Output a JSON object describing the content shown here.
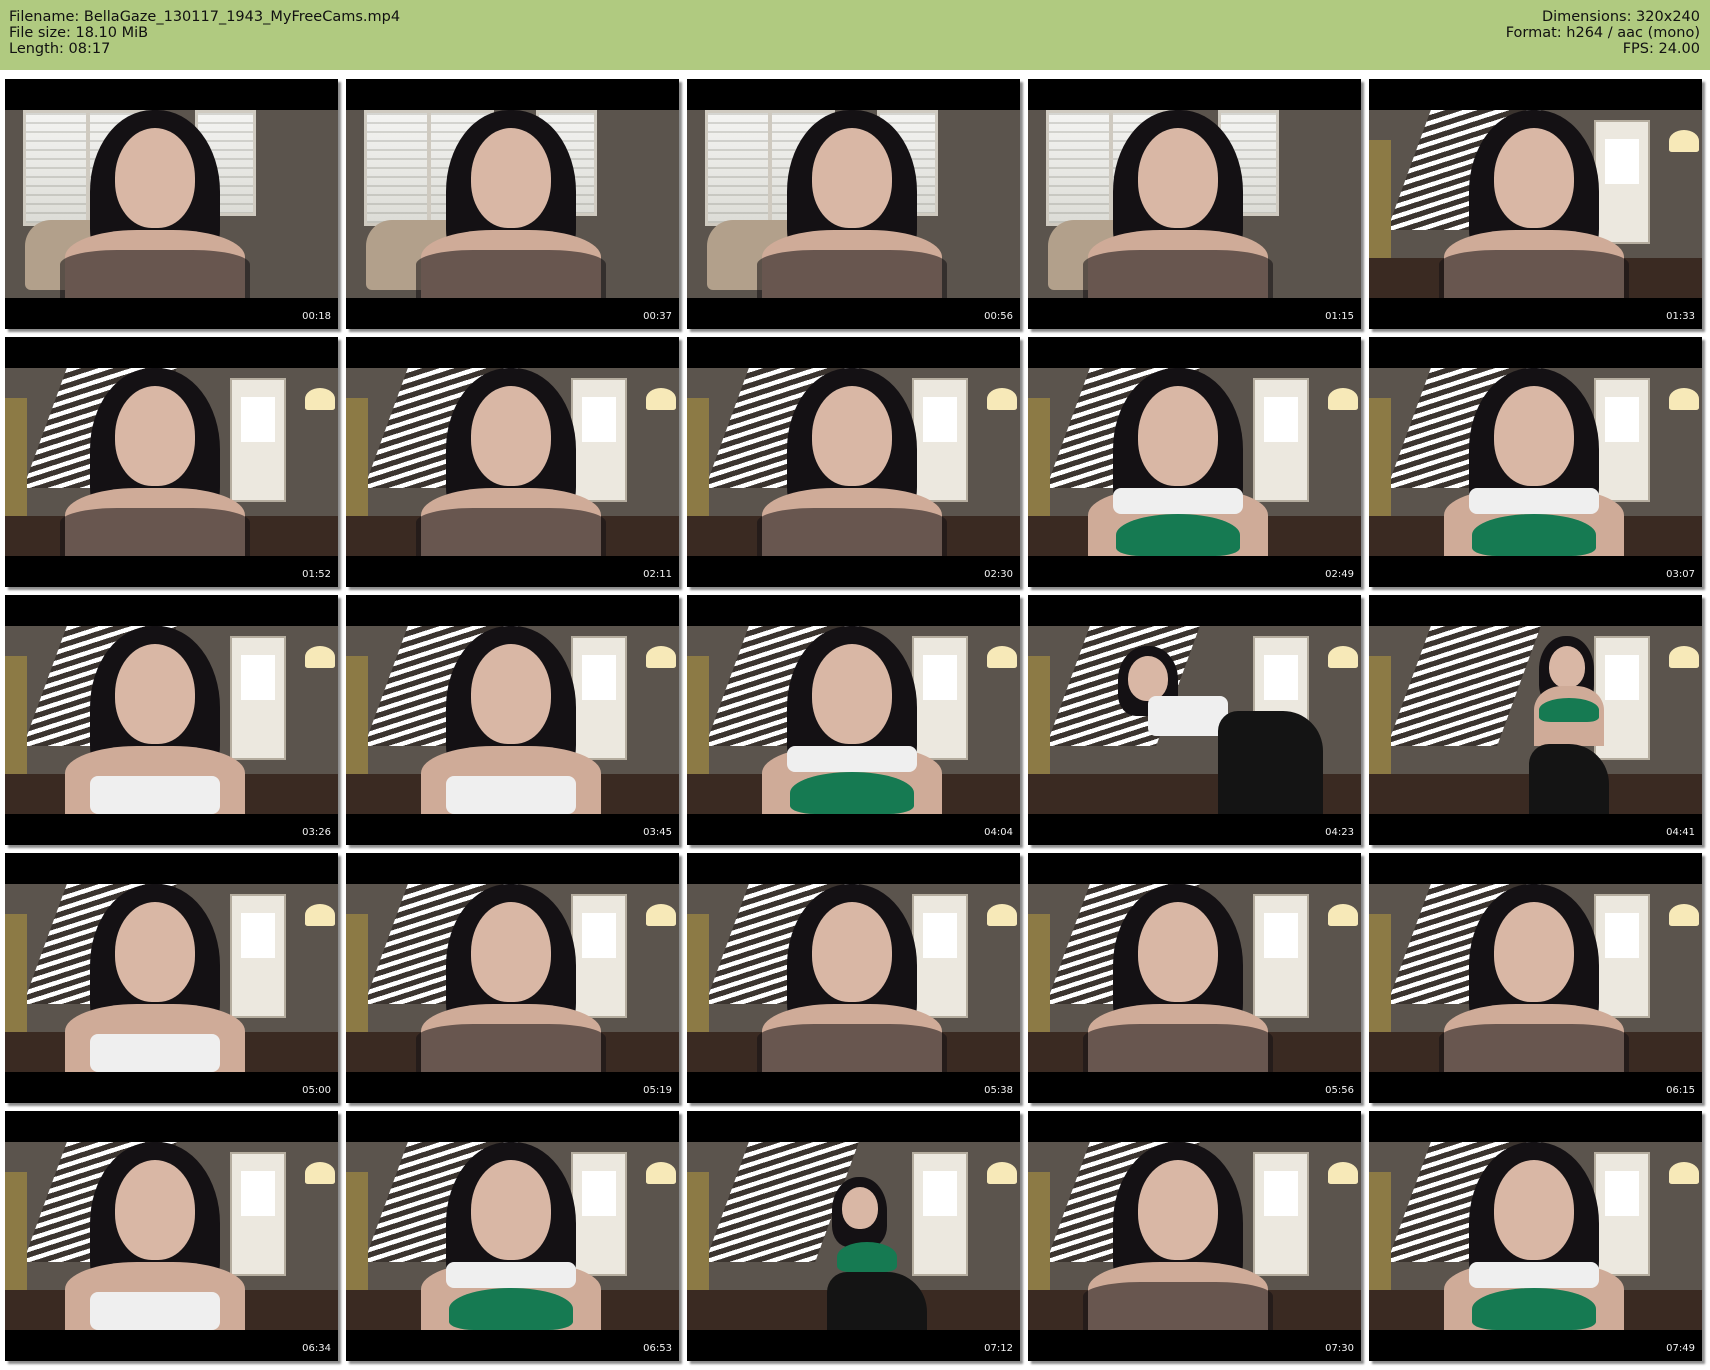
{
  "header": {
    "filename": "Filename: BellaGaze_130117_1943_MyFreeCams.mp4",
    "filesize": "File size: 18.10 MiB",
    "length": "Length: 08:17",
    "dimensions": "Dimensions: 320x240",
    "format": "Format: h264 / aac (mono)",
    "fps": "FPS: 24.00"
  },
  "colors": {
    "header_bg": "#b0ca80",
    "page_bg": "#ffffff",
    "frame_bg": "#000000",
    "timestamp_text": "#f2f2f2"
  },
  "thumbnails": [
    {
      "time": "00:18",
      "scene": "living",
      "outfit": "dark"
    },
    {
      "time": "00:37",
      "scene": "living",
      "outfit": "dark"
    },
    {
      "time": "00:56",
      "scene": "living",
      "outfit": "dark"
    },
    {
      "time": "01:15",
      "scene": "living",
      "outfit": "dark"
    },
    {
      "time": "01:33",
      "scene": "stairs",
      "outfit": "dark"
    },
    {
      "time": "01:52",
      "scene": "stairs",
      "outfit": "dark"
    },
    {
      "time": "02:11",
      "scene": "stairs",
      "outfit": "dark"
    },
    {
      "time": "02:30",
      "scene": "stairs",
      "outfit": "dark"
    },
    {
      "time": "02:49",
      "scene": "stairs",
      "outfit": "green"
    },
    {
      "time": "03:07",
      "scene": "stairs",
      "outfit": "green"
    },
    {
      "time": "03:26",
      "scene": "stairs",
      "outfit": "white"
    },
    {
      "time": "03:45",
      "scene": "stairs",
      "outfit": "white"
    },
    {
      "time": "04:04",
      "scene": "stairs",
      "outfit": "green"
    },
    {
      "time": "04:23",
      "scene": "stairs",
      "outfit": "bend"
    },
    {
      "time": "04:41",
      "scene": "stairs",
      "outfit": "standing"
    },
    {
      "time": "05:00",
      "scene": "stairs",
      "outfit": "white"
    },
    {
      "time": "05:19",
      "scene": "stairs",
      "outfit": "dark"
    },
    {
      "time": "05:38",
      "scene": "stairs",
      "outfit": "dark"
    },
    {
      "time": "05:56",
      "scene": "stairs",
      "outfit": "dark"
    },
    {
      "time": "06:15",
      "scene": "stairs",
      "outfit": "dark"
    },
    {
      "time": "06:34",
      "scene": "stairs",
      "outfit": "white"
    },
    {
      "time": "06:53",
      "scene": "stairs",
      "outfit": "green"
    },
    {
      "time": "07:12",
      "scene": "stairs",
      "outfit": "sitting"
    },
    {
      "time": "07:30",
      "scene": "stairs",
      "outfit": "dark"
    },
    {
      "time": "07:49",
      "scene": "stairs",
      "outfit": "green"
    }
  ]
}
